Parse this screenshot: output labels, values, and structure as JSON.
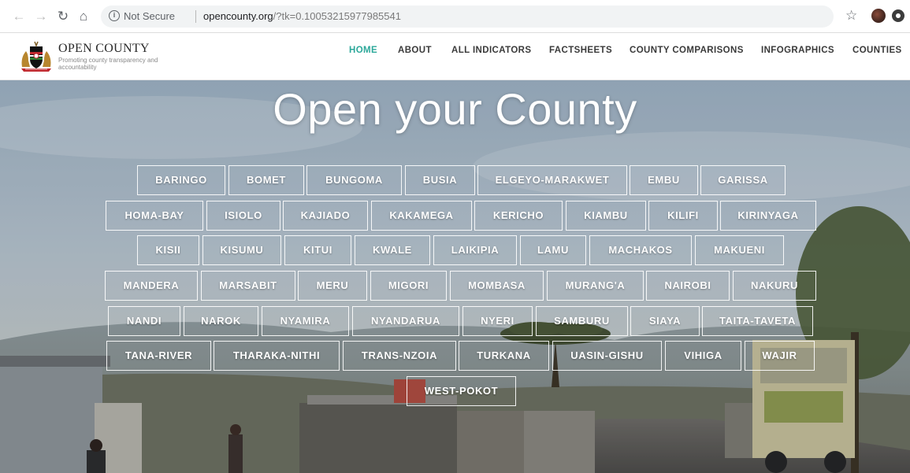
{
  "browser": {
    "secure_label": "Not Secure",
    "url_host": "opencounty.org",
    "url_rest": "/?tk=0.10053215977985541"
  },
  "site": {
    "brand_name": "OPEN COUNTY",
    "brand_tagline": "Promoting county transparency and accountability"
  },
  "nav": [
    {
      "label": "HOME",
      "active": true
    },
    {
      "label": "ABOUT",
      "active": false
    },
    {
      "label": "ALL INDICATORS",
      "active": false
    },
    {
      "label": "FACTSHEETS",
      "active": false
    },
    {
      "label": "COUNTY COMPARISONS",
      "active": false
    },
    {
      "label": "INFOGRAPHICS",
      "active": false
    },
    {
      "label": "COUNTIES",
      "active": false
    }
  ],
  "hero": {
    "title": "Open your County"
  },
  "counties": [
    "BARINGO",
    "BOMET",
    "BUNGOMA",
    "BUSIA",
    "ELGEYO-MARAKWET",
    "EMBU",
    "GARISSA",
    "HOMA-BAY",
    "ISIOLO",
    "KAJIADO",
    "KAKAMEGA",
    "KERICHO",
    "KIAMBU",
    "KILIFI",
    "KIRINYAGA",
    "KISII",
    "KISUMU",
    "KITUI",
    "KWALE",
    "LAIKIPIA",
    "LAMU",
    "MACHAKOS",
    "MAKUENI",
    "MANDERA",
    "MARSABIT",
    "MERU",
    "MIGORI",
    "MOMBASA",
    "MURANG'A",
    "NAIROBI",
    "NAKURU",
    "NANDI",
    "NAROK",
    "NYAMIRA",
    "NYANDARUA",
    "NYERI",
    "SAMBURU",
    "SIAYA",
    "TAITA-TAVETA",
    "TANA-RIVER",
    "THARAKA-NITHI",
    "TRANS-NZOIA",
    "TURKANA",
    "UASIN-GISHU",
    "VIHIGA",
    "WAJIR",
    "WEST-POKOT"
  ],
  "colors": {
    "nav_active": "#2ca89a",
    "nav_text": "#3a3a3a",
    "button_border": "#ffffff"
  }
}
